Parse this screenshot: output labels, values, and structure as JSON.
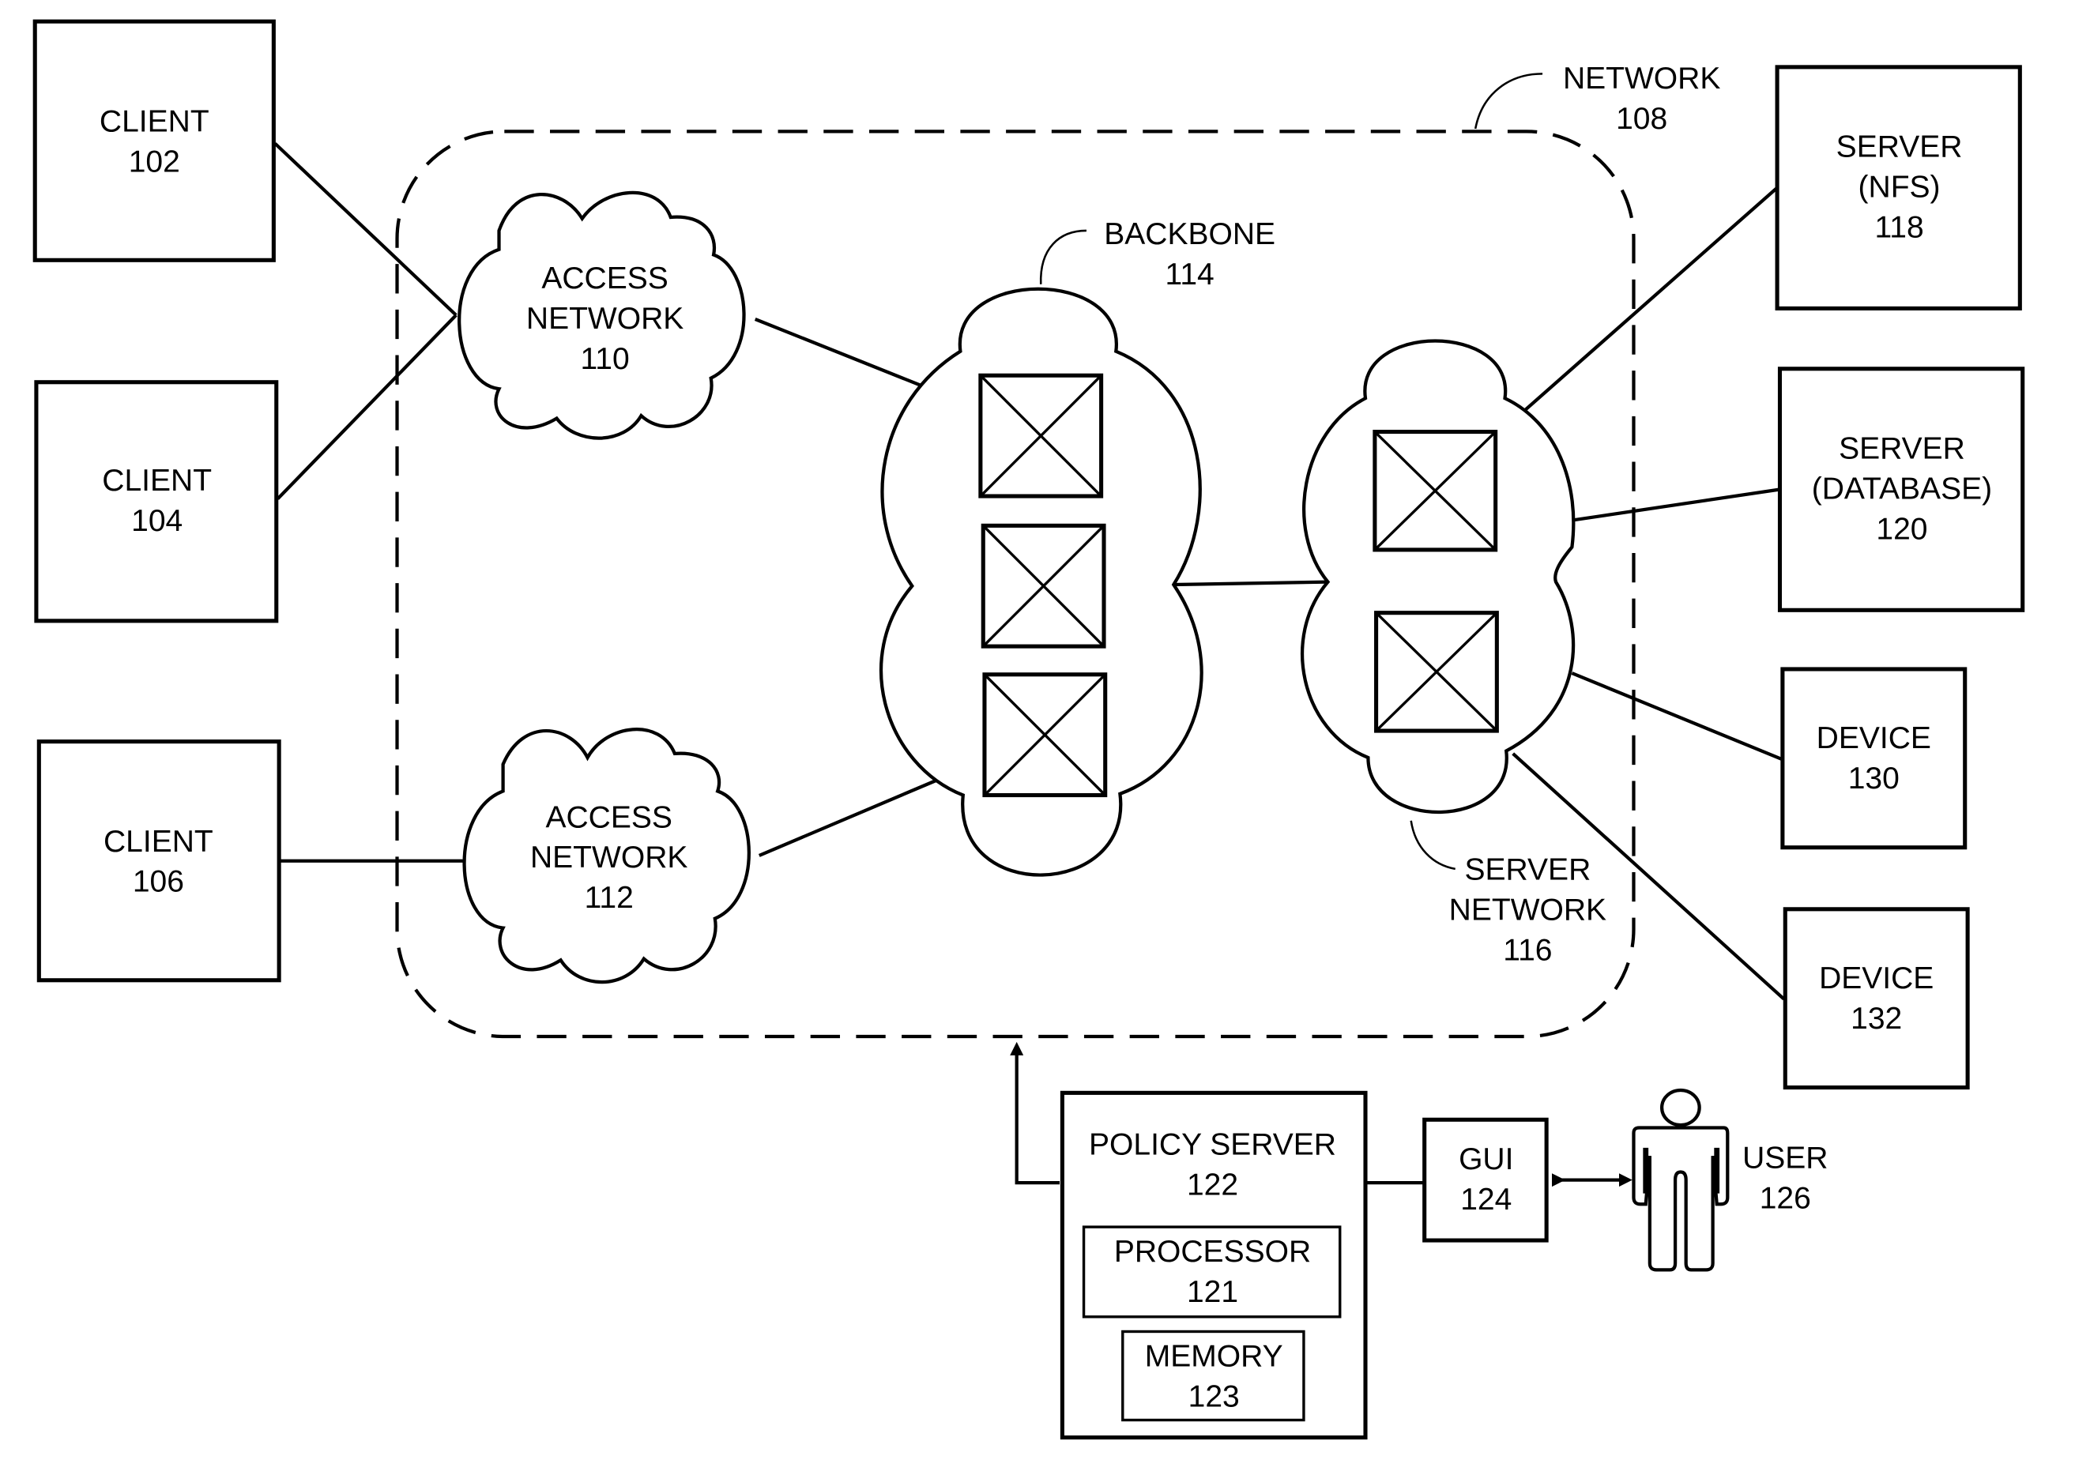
{
  "diagram": {
    "network": {
      "name": "NETWORK",
      "ref": "108"
    },
    "clients": [
      {
        "name": "CLIENT",
        "ref": "102"
      },
      {
        "name": "CLIENT",
        "ref": "104"
      },
      {
        "name": "CLIENT",
        "ref": "106"
      }
    ],
    "access_networks": [
      {
        "line1": "ACCESS",
        "line2": "NETWORK",
        "ref": "110"
      },
      {
        "line1": "ACCESS",
        "line2": "NETWORK",
        "ref": "112"
      }
    ],
    "backbone": {
      "name": "BACKBONE",
      "ref": "114"
    },
    "server_network": {
      "line1": "SERVER",
      "line2": "NETWORK",
      "ref": "116"
    },
    "servers": [
      {
        "line1": "SERVER",
        "line2": "(NFS)",
        "ref": "118"
      },
      {
        "line1": "SERVER",
        "line2": "(DATABASE)",
        "ref": "120"
      }
    ],
    "devices": [
      {
        "name": "DEVICE",
        "ref": "130"
      },
      {
        "name": "DEVICE",
        "ref": "132"
      }
    ],
    "policy_server": {
      "name": "POLICY SERVER",
      "ref": "122"
    },
    "processor": {
      "name": "PROCESSOR",
      "ref": "121"
    },
    "memory": {
      "name": "MEMORY",
      "ref": "123"
    },
    "gui": {
      "name": "GUI",
      "ref": "124"
    },
    "user": {
      "name": "USER",
      "ref": "126"
    }
  }
}
